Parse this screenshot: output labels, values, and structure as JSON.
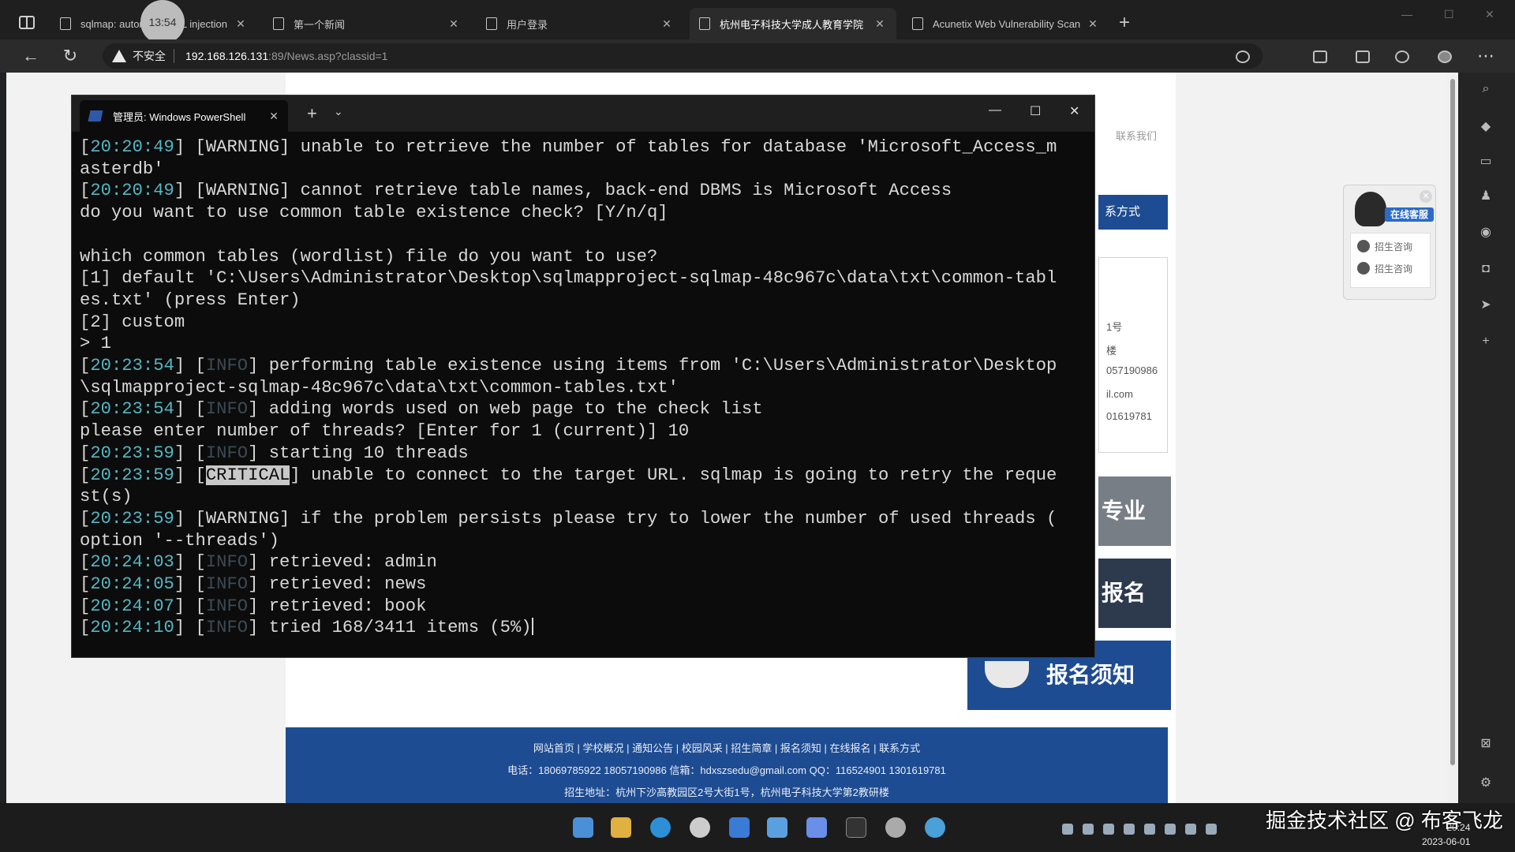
{
  "browser": {
    "tabs": [
      {
        "label": "sqlmap: automatic SQL injection",
        "active": false
      },
      {
        "label": "第一个新闻",
        "active": false
      },
      {
        "label": "用户登录",
        "active": false
      },
      {
        "label": "杭州电子科技大学成人教育学院",
        "active": true
      },
      {
        "label": "Acunetix Web Vulnerability Scanner",
        "active": false
      }
    ],
    "overlay_timer": "13:54",
    "security_label": "不安全",
    "url_host": "192.168.126.131",
    "url_rest": ":89/News.asp?classid=1"
  },
  "page": {
    "contact_us": "联系我们",
    "contact_header": "系方式",
    "info_lines": [
      "1号",
      "楼",
      "057190986",
      "il.com",
      "01619781"
    ],
    "banner_major": "专业",
    "banner_signup": "报名",
    "banner_notice": "报名须知",
    "kefu_badge": "在线客服",
    "kefu_items": [
      "招生咨询",
      "招生咨询"
    ],
    "footer_links": "网站首页 | 学校概况 | 通知公告 | 校园风采 | 招生简章 | 报名须知 | 在线报名 | 联系方式",
    "footer_contact": "电话：18069785922 18057190986  信箱：hdxszsedu@gmail.com  QQ：116524901 1301619781",
    "footer_address": "招生地址：杭州下沙高教园区2号大街1号，杭州电子科技大学第2教研楼"
  },
  "terminal": {
    "tab_title": "管理员: Windows PowerShell",
    "lines": [
      {
        "ts": "20:20:49",
        "level": "WARNING",
        "text": " unable to retrieve the number of tables for database 'Microsoft_Access_m"
      },
      {
        "plain": "asterdb'"
      },
      {
        "ts": "20:20:49",
        "level": "WARNING",
        "text": " cannot retrieve table names, back-end DBMS is Microsoft Access"
      },
      {
        "plain": "do you want to use common table existence check? [Y/n/q]"
      },
      {
        "plain": ""
      },
      {
        "plain": "which common tables (wordlist) file do you want to use?"
      },
      {
        "plain": "[1] default 'C:\\Users\\Administrator\\Desktop\\sqlmapproject-sqlmap-48c967c\\data\\txt\\common-tabl"
      },
      {
        "plain": "es.txt' (press Enter)"
      },
      {
        "plain": "[2] custom"
      },
      {
        "plain": "> 1"
      },
      {
        "ts": "20:23:54",
        "level": "INFO",
        "text": " performing table existence using items from 'C:\\Users\\Administrator\\Desktop"
      },
      {
        "plain": "\\sqlmapproject-sqlmap-48c967c\\data\\txt\\common-tables.txt'"
      },
      {
        "ts": "20:23:54",
        "level": "INFO",
        "text": " adding words used on web page to the check list"
      },
      {
        "plain": "please enter number of threads? [Enter for 1 (current)] 10"
      },
      {
        "ts": "20:23:59",
        "level": "INFO",
        "text": " starting 10 threads"
      },
      {
        "ts": "20:23:59",
        "level": "CRITICAL",
        "text": " unable to connect to the target URL. sqlmap is going to retry the reque"
      },
      {
        "plain": "st(s)"
      },
      {
        "ts": "20:23:59",
        "level": "WARNING",
        "text": " if the problem persists please try to lower the number of used threads ("
      },
      {
        "plain": "option '--threads')"
      },
      {
        "ts": "20:24:03",
        "level": "INFO",
        "text": " retrieved: admin"
      },
      {
        "ts": "20:24:05",
        "level": "INFO",
        "text": " retrieved: news"
      },
      {
        "ts": "20:24:07",
        "level": "INFO",
        "text": " retrieved: book"
      },
      {
        "ts": "20:24:10",
        "level": "INFO",
        "text": " tried 168/3411 items (5%)",
        "cursor": true
      }
    ]
  },
  "taskbar": {
    "clock_time": "20:24",
    "clock_date": "2023-06-01"
  },
  "watermark": "掘金技术社区 @ 布客飞龙",
  "colors": {
    "terminal_bg": "#0c0c0c",
    "timestamp": "#56b6c2",
    "page_blue": "#1e4c92"
  }
}
